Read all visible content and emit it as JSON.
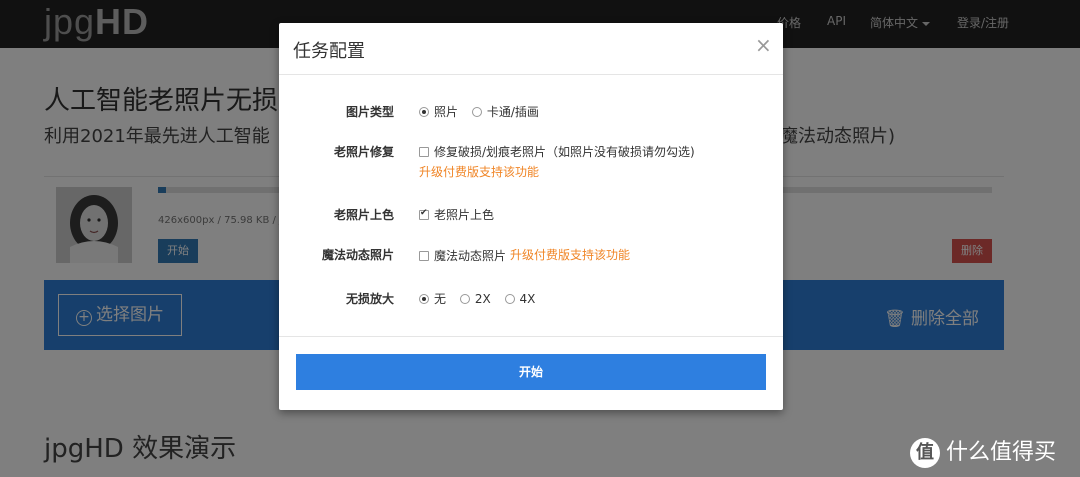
{
  "navbar": {
    "logo_light": "jpg",
    "logo_bold": "HD",
    "links": [
      "价格",
      "API",
      "简体中文",
      "登录/注册"
    ]
  },
  "page": {
    "hero_title": "人工智能老照片无损",
    "hero_subtitle": "利用2021年最先进人工智能",
    "hero_subtitle_end": "魔法动态照片)",
    "file": {
      "meta": "426x600px / 75.98 KB / j",
      "progress_fraction": 0.01,
      "start_label": "开始",
      "delete_label": "删除"
    },
    "select_button_label": "选择图片",
    "delete_all_label": "删除全部",
    "demo_title": "jpgHD 效果演示"
  },
  "watermark": {
    "text": "什么值得买"
  },
  "modal": {
    "title": "任务配置",
    "close": "×",
    "rows": [
      {
        "label": "图片类型",
        "type": "radio",
        "options": [
          {
            "text": "照片",
            "checked": true
          },
          {
            "text": "卡通/插画",
            "checked": false
          }
        ]
      },
      {
        "label": "老照片修复",
        "type": "checkbox",
        "options": [
          {
            "text": "修复破损/划痕老照片（如照片没有破损请勿勾选)",
            "checked": false
          }
        ],
        "upgrade": "升级付费版支持该功能"
      },
      {
        "label": "老照片上色",
        "type": "checkbox",
        "options": [
          {
            "text": "老照片上色",
            "checked": true
          }
        ]
      },
      {
        "label": "魔法动态照片",
        "type": "checkbox",
        "options": [
          {
            "text": "魔法动态照片",
            "checked": false
          }
        ],
        "upgrade_inline": "升级付费版支持该功能"
      },
      {
        "label": "无损放大",
        "type": "radio",
        "options": [
          {
            "text": "无",
            "checked": true
          },
          {
            "text": "2X",
            "checked": false
          },
          {
            "text": "4X",
            "checked": false
          }
        ]
      }
    ],
    "start_label": "开始"
  },
  "colors": {
    "navbar": "#222222",
    "primary": "#2e7fe0",
    "danger": "#d9534f",
    "upgrade": "#f08526"
  }
}
